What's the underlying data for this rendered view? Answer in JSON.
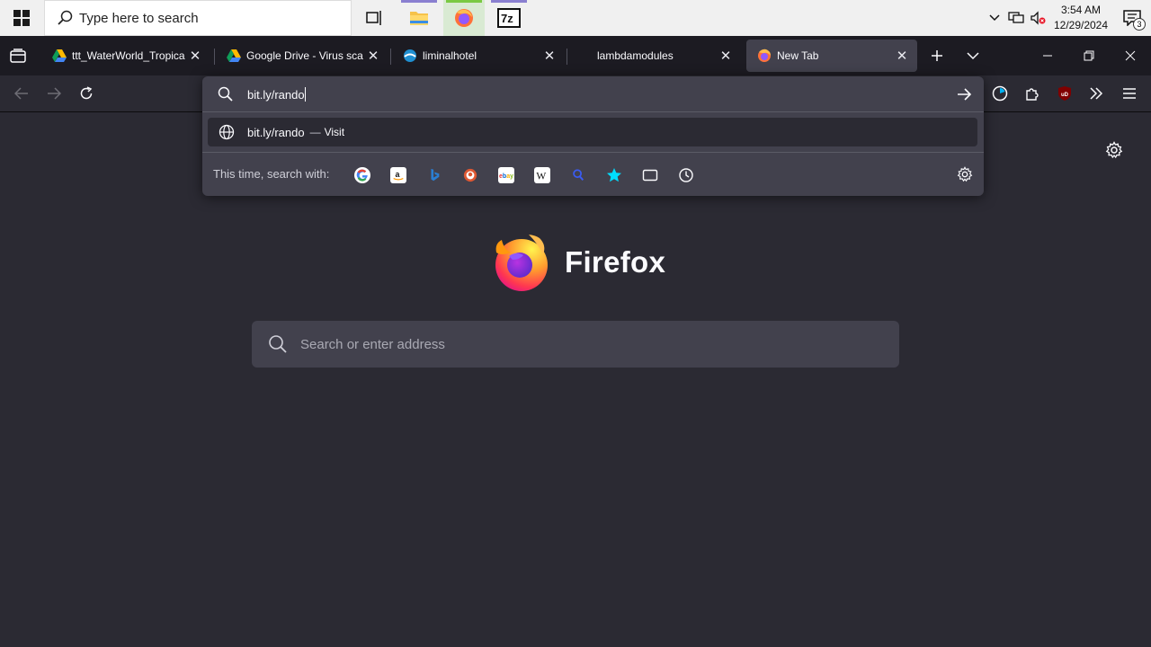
{
  "taskbar": {
    "search_placeholder": "Type here to search",
    "clock_time": "3:54 AM",
    "clock_date": "12/29/2024",
    "notification_count": "3",
    "apps": [
      "task-view",
      "file-explorer",
      "firefox",
      "7zip"
    ]
  },
  "tabs": [
    {
      "title": "ttt_WaterWorld_Tropical.zi",
      "favicon": "google-drive-icon",
      "selected": false
    },
    {
      "title": "Google Drive - Virus scan",
      "favicon": "google-drive-icon",
      "selected": false
    },
    {
      "title": "liminalhotel",
      "favicon": "web-icon",
      "selected": false
    },
    {
      "title": "lambdamodules",
      "favicon": "",
      "selected": false
    },
    {
      "title": "New Tab",
      "favicon": "firefox-icon",
      "selected": true
    }
  ],
  "urlbar": {
    "value": "bit.ly/rando",
    "result_text": "bit.ly/rando",
    "result_separator": "—",
    "result_action": "Visit",
    "search_with_label": "This time, search with:",
    "engines": [
      "Google",
      "Amazon",
      "Bing",
      "DuckDuckGo",
      "eBay",
      "Wikipedia",
      "Search",
      "Bookmarks",
      "Tabs",
      "History"
    ]
  },
  "newtab": {
    "brand": "Firefox",
    "search_placeholder": "Search or enter address"
  },
  "colors": {
    "bg": "#2b2a33",
    "tabstrip": "#1c1b22",
    "panel": "#42414d",
    "accent": "#00ddff"
  }
}
